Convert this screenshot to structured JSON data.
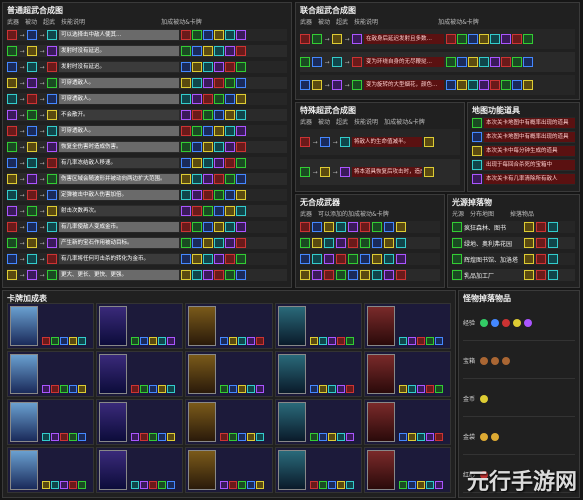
{
  "panels": {
    "normal": {
      "title": "普通超武合成图",
      "headers": [
        "武器",
        "被动",
        "超武",
        "技能说明",
        "加成被动&卡牌"
      ],
      "rows": [
        {
          "desc": "可以选择击中敌人使其…"
        },
        {
          "desc": "发射时没有延迟。"
        },
        {
          "desc": "发射时没有延迟。"
        },
        {
          "desc": "可穿透敌人。"
        },
        {
          "desc": "可穿透敌人。"
        },
        {
          "desc": "不会散开。"
        },
        {
          "desc": "可穿透敌人。"
        },
        {
          "desc": "恢复全伤害时造成伤害。"
        },
        {
          "desc": "有几率冻结敌人移速。"
        },
        {
          "desc": "伤害区域会随波形并被动向两边扩大范围。"
        },
        {
          "desc": "定弹被击中敌人伤害加倍。"
        },
        {
          "desc": "射击次数再次。"
        },
        {
          "desc": "有几率使敌人变成金币。"
        },
        {
          "desc": "产生新的宝石作用被动目标。"
        },
        {
          "desc": "有几率将任何可击杀的转化为金币。"
        },
        {
          "desc": "更大、更长、更快、更强。"
        }
      ]
    },
    "union": {
      "title": "联合超武合成图",
      "headers": [
        "武器",
        "被动",
        "超武",
        "技能说明",
        "加成被动&卡牌"
      ],
      "rows": [
        {
          "desc": "在敌身后延迟发射且多数…"
        },
        {
          "desc": "变为环绕自身的无尽鞭挞…"
        },
        {
          "desc": "变为旋转的大型烟花，颜色…"
        }
      ]
    },
    "special": {
      "title": "特殊超武合成图",
      "headers": [
        "武器",
        "被动",
        "超武",
        "技能说明",
        "加成被动&卡牌"
      ],
      "rows": [
        {
          "desc": "将敌人的生命值减半。"
        },
        {
          "desc": "将本道具恢复后攻击时，造成…"
        }
      ]
    },
    "nocombine": {
      "title": "无合成武器",
      "headers": [
        "武器",
        "可以添加的加成被动&卡牌"
      ]
    },
    "map": {
      "title": "地图功能道具",
      "items": [
        "本次关卡地图中有概率出现的道具",
        "本次关卡地图中有概率出现的道具",
        "本次关卡中每分钟生成的道具",
        "出现于每回合杀死的宝箱中",
        "本次关卡有几率清除所有敌人"
      ]
    },
    "light": {
      "title": "光源掉落物",
      "headers": [
        "光源",
        "分布地图",
        "掉落物品"
      ],
      "rows": [
        "疯狂森林、图书",
        "绿地、奥利弗花园",
        "辉煌图书馆、加洛塔",
        "乳品加工厂"
      ]
    },
    "cards": {
      "title": "卡牌加成表"
    },
    "enemyDrops": {
      "title": "怪物掉落物品",
      "rows": [
        "经验",
        "宝箱",
        "金币",
        "金袋",
        "红心"
      ]
    }
  },
  "watermark": "元行手游网",
  "colors": {
    "accent_red": "#cc3333",
    "accent_green": "#33cc33",
    "accent_blue": "#4488ff",
    "accent_yellow": "#ddcc33"
  }
}
